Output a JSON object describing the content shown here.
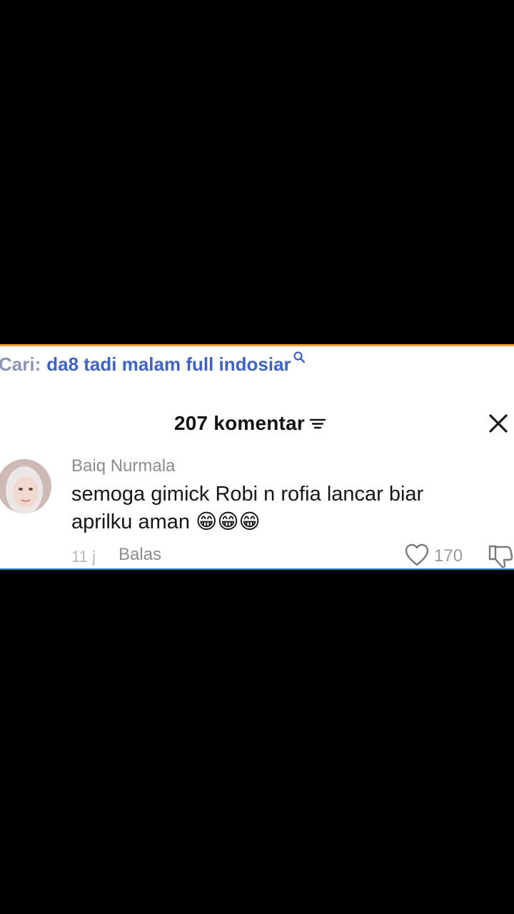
{
  "search": {
    "prefix": "Cari:",
    "query": "da8 tadi malam full indosiar"
  },
  "header": {
    "comment_count": "207 komentar"
  },
  "comment": {
    "username": "Baiq Nurmala",
    "text": "semoga gimick Robi n rofia lancar biar aprilku aman ",
    "emojis": "😁😁😁",
    "time": "11 j",
    "reply_label": "Balas",
    "like_count": "170"
  },
  "icons": {
    "search": "search-icon",
    "sort": "sort-icon",
    "close": "close-icon",
    "like": "heart-icon",
    "dislike": "thumbs-down-icon"
  },
  "colors": {
    "accent_top": "#f6a03c",
    "accent_bottom": "#2f7cff",
    "search_query": "#3e63c4"
  }
}
